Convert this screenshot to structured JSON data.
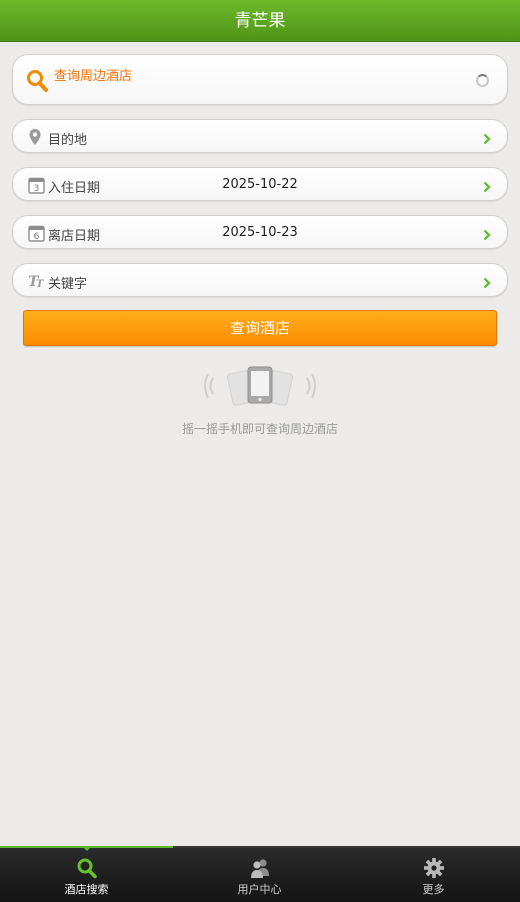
{
  "header": {
    "title": "青芒果"
  },
  "search_nearby": {
    "label": "查询周边酒店"
  },
  "form": {
    "destination": {
      "label": "目的地",
      "value": ""
    },
    "checkin": {
      "label": "入住日期",
      "value": "2025-10-22",
      "icon_day": "3"
    },
    "checkout": {
      "label": "离店日期",
      "value": "2025-10-23",
      "icon_day": "6"
    },
    "keyword": {
      "label": "关键字",
      "value": ""
    }
  },
  "search_button": {
    "label": "查询酒店"
  },
  "shake": {
    "hint": "摇一摇手机即可查询周边酒店"
  },
  "tabbar": {
    "tabs": [
      {
        "label": "酒店搜索",
        "icon": "search-icon",
        "active": true
      },
      {
        "label": "用户中心",
        "icon": "users-icon",
        "active": false
      },
      {
        "label": "更多",
        "icon": "gear-icon",
        "active": false
      }
    ]
  },
  "colors": {
    "header": "#5aa51f",
    "accent_orange": "#f2730a",
    "button": "#ff9c0c",
    "chevron": "#5cb82a"
  }
}
